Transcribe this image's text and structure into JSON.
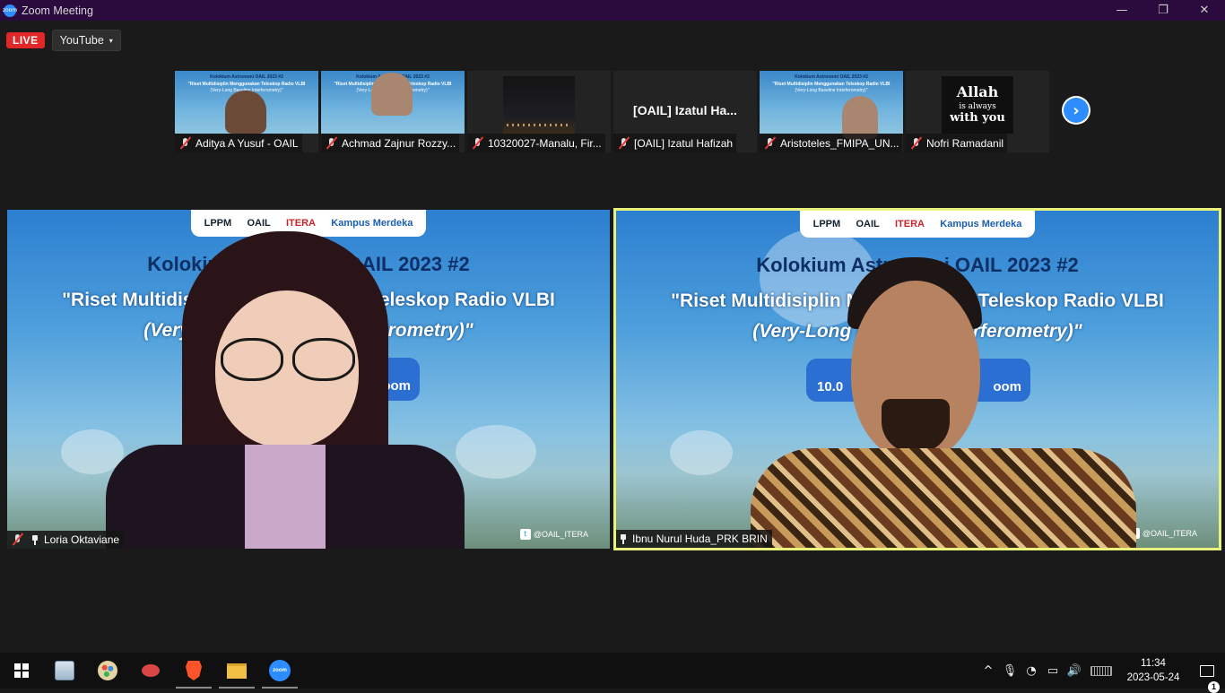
{
  "window": {
    "title": "Zoom Meeting",
    "app_icon_text": "zoom",
    "minimize": "—",
    "restore": "❐",
    "close": "✕"
  },
  "live": {
    "badge": "LIVE",
    "platform": "YouTube",
    "caret": "▾"
  },
  "thumbnails": [
    {
      "name": "Aditya A Yusuf - OAIL",
      "muted": true,
      "kind": "video-slide"
    },
    {
      "name": "Achmad Zajnur Rozzy...",
      "muted": true,
      "kind": "video-slide"
    },
    {
      "name": "10320027-Manalu, Fir...",
      "muted": true,
      "kind": "video-dark"
    },
    {
      "name": "[OAIL] Izatul Hafizah",
      "muted": true,
      "kind": "name-only",
      "display_name": "[OAIL] Izatul Ha..."
    },
    {
      "name": "Aristoteles_FMIPA_UN...",
      "muted": true,
      "kind": "video-slide"
    },
    {
      "name": "Nofri Ramadanil",
      "muted": true,
      "kind": "avatar-image"
    }
  ],
  "thumb_slide": {
    "line1": "Kolokium Astronomi OAIL 2023 #2",
    "line2": "\"Riset Multidisiplin Menggunakan Teleskop Radio VLBI",
    "line3": "(Very-Long Baseline Interferometry)\""
  },
  "avatar_image": {
    "line1": "Allah",
    "line2": "is always",
    "line3": "with you"
  },
  "next_button": "›",
  "slide": {
    "logos": [
      "LPPM",
      "OAIL",
      "ITERA",
      "Kampus Merdeka"
    ],
    "title": "Kolokium Astronomi OAIL 2023 #2",
    "subtitle": "\"Riset Multidisiplin Menggunakan Teleskop Radio VLBI",
    "subtitle2": "(Very-Long Baseline Interferometry)\"",
    "twitter": "@OAIL_ITERA",
    "twitter_icon": "t"
  },
  "tiles": [
    {
      "name": "Loria Oktaviane",
      "muted": true,
      "pinned": true,
      "pill_text": "Zoom"
    },
    {
      "name": "Ibnu Nurul Huda_PRK BRIN",
      "muted": false,
      "pinned": true,
      "active_speaker": true,
      "pill_text_left": "10.0",
      "pill_text_right": "oom"
    }
  ],
  "taskbar": {
    "apps": [
      "start",
      "calculator",
      "paint",
      "snipping-tool",
      "brave",
      "file-explorer",
      "zoom"
    ],
    "zoom_icon_text": "zoom",
    "tray": {
      "chevron": "^",
      "mic": "🎙",
      "wifi": "◔",
      "battery": "▭",
      "volume": "🔊"
    },
    "time": "11:34",
    "date": "2023-05-24",
    "notifications": "1"
  }
}
